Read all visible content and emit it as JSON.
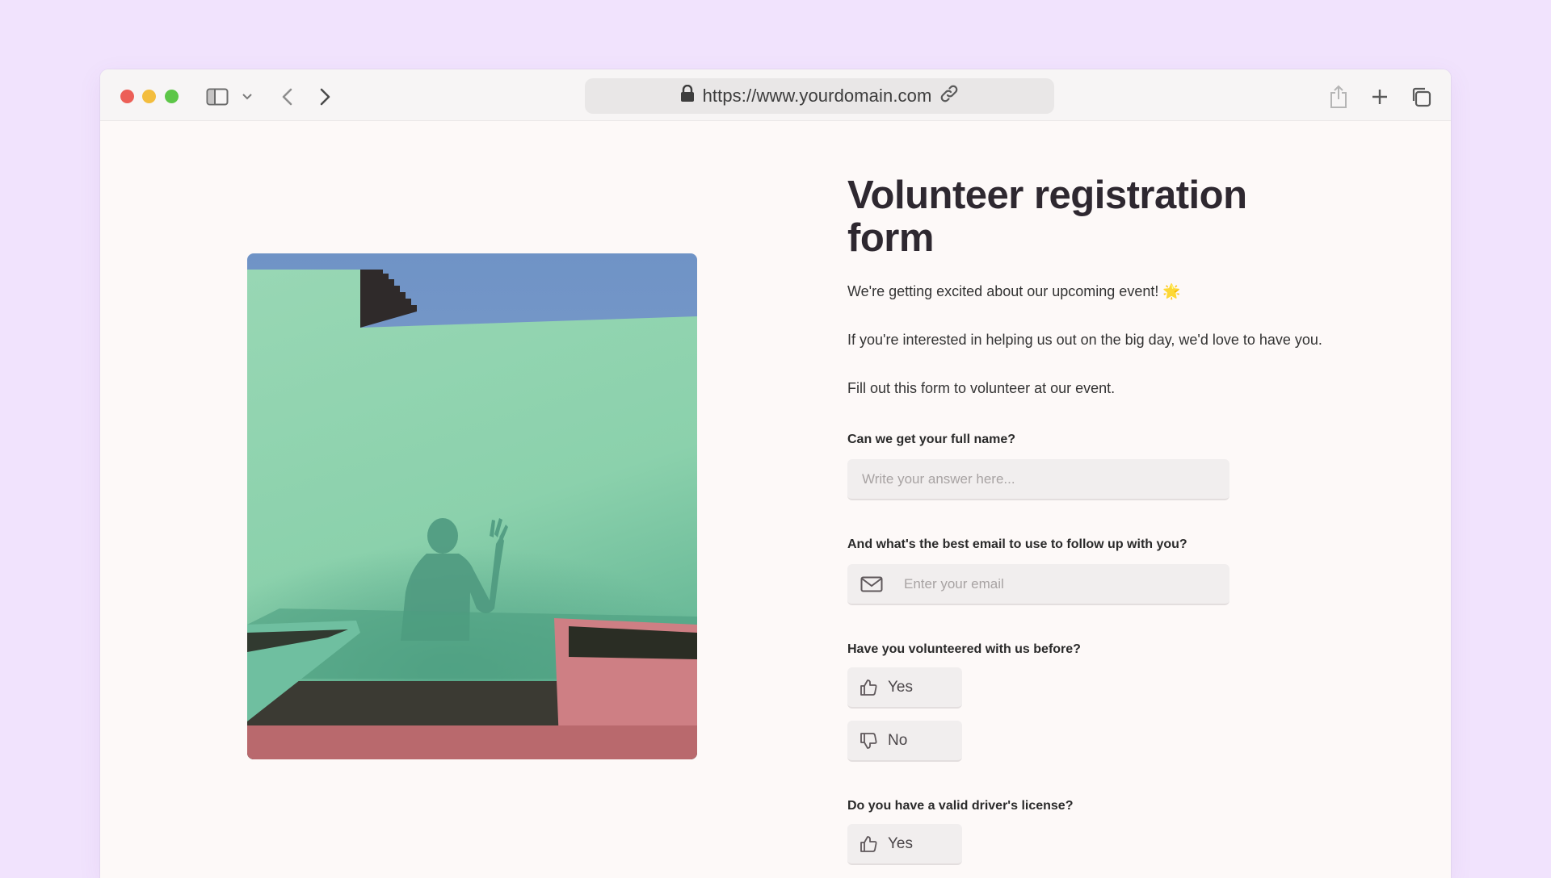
{
  "browser": {
    "url": "https://www.yourdomain.com",
    "icons": {
      "sidebar": "sidebar-icon",
      "chevron": "chevron-down-icon",
      "back": "chevron-left-icon",
      "forward": "chevron-right-icon",
      "lock": "lock-icon",
      "link": "link-icon",
      "share": "share-icon",
      "new_tab": "plus-icon",
      "tabs": "tabs-overview-icon"
    }
  },
  "form": {
    "title": "Volunteer registration form",
    "intro": "We're getting excited about our upcoming event! 🌟",
    "help_text": "If you're interested in helping us out on the big day, we'd love to have you.",
    "cta_text": "Fill out this form to volunteer at our event.",
    "questions": [
      {
        "label": "Can we get your full name?",
        "placeholder": "Write your answer here..."
      },
      {
        "label": "And what's the best email to use to follow up with you?",
        "placeholder": "Enter your email"
      },
      {
        "label": "Have you volunteered with us before?",
        "options": [
          "Yes",
          "No"
        ]
      },
      {
        "label": "Do you have a valid driver's license?",
        "options": [
          "Yes"
        ]
      }
    ]
  },
  "colors": {
    "page_background": "#f1e3fd",
    "window_background": "#fdf9f8",
    "title_text": "#2e2830",
    "field_background": "#f1eeee"
  }
}
